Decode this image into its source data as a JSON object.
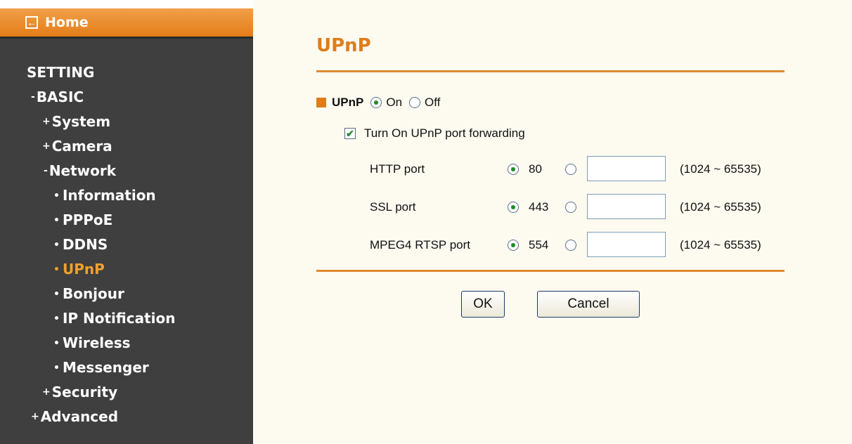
{
  "sidebar": {
    "home_label": "Home",
    "items": [
      {
        "prefix": "",
        "label": "SETTING"
      },
      {
        "prefix": "-",
        "label": "BASIC"
      },
      {
        "prefix": "+",
        "label": "System"
      },
      {
        "prefix": "+",
        "label": "Camera"
      },
      {
        "prefix": "-",
        "label": "Network"
      },
      {
        "prefix": "•",
        "label": "Information"
      },
      {
        "prefix": "•",
        "label": "PPPoE"
      },
      {
        "prefix": "•",
        "label": "DDNS"
      },
      {
        "prefix": "•",
        "label": "UPnP",
        "active": true
      },
      {
        "prefix": "•",
        "label": "Bonjour"
      },
      {
        "prefix": "•",
        "label": "IP Notification"
      },
      {
        "prefix": "•",
        "label": "Wireless"
      },
      {
        "prefix": "•",
        "label": "Messenger"
      },
      {
        "prefix": "+",
        "label": "Security"
      },
      {
        "prefix": "+",
        "label": "Advanced"
      }
    ]
  },
  "main": {
    "title": "UPnP",
    "upnp": {
      "label": "UPnP",
      "on_label": "On",
      "off_label": "Off",
      "selected": "On"
    },
    "port_forwarding": {
      "label": "Turn On UPnP port forwarding",
      "checked": true
    },
    "ports": [
      {
        "label": "HTTP port",
        "default": "80",
        "custom_value": "",
        "range": "(1024 ~ 65535)",
        "selected": "default"
      },
      {
        "label": "SSL port",
        "default": "443",
        "custom_value": "",
        "range": "(1024 ~ 65535)",
        "selected": "default"
      },
      {
        "label": "MPEG4 RTSP port",
        "default": "554",
        "custom_value": "",
        "range": "(1024 ~ 65535)",
        "selected": "default"
      }
    ],
    "buttons": {
      "ok": "OK",
      "cancel": "Cancel"
    }
  },
  "colors": {
    "accent": "#e07d18",
    "sidebar_bg": "#3f3f3f",
    "content_bg": "#fdfaf0",
    "active_nav": "#f0a030"
  },
  "icons": {
    "home": "back-arrow-icon",
    "bullet": "orange-square-icon"
  }
}
